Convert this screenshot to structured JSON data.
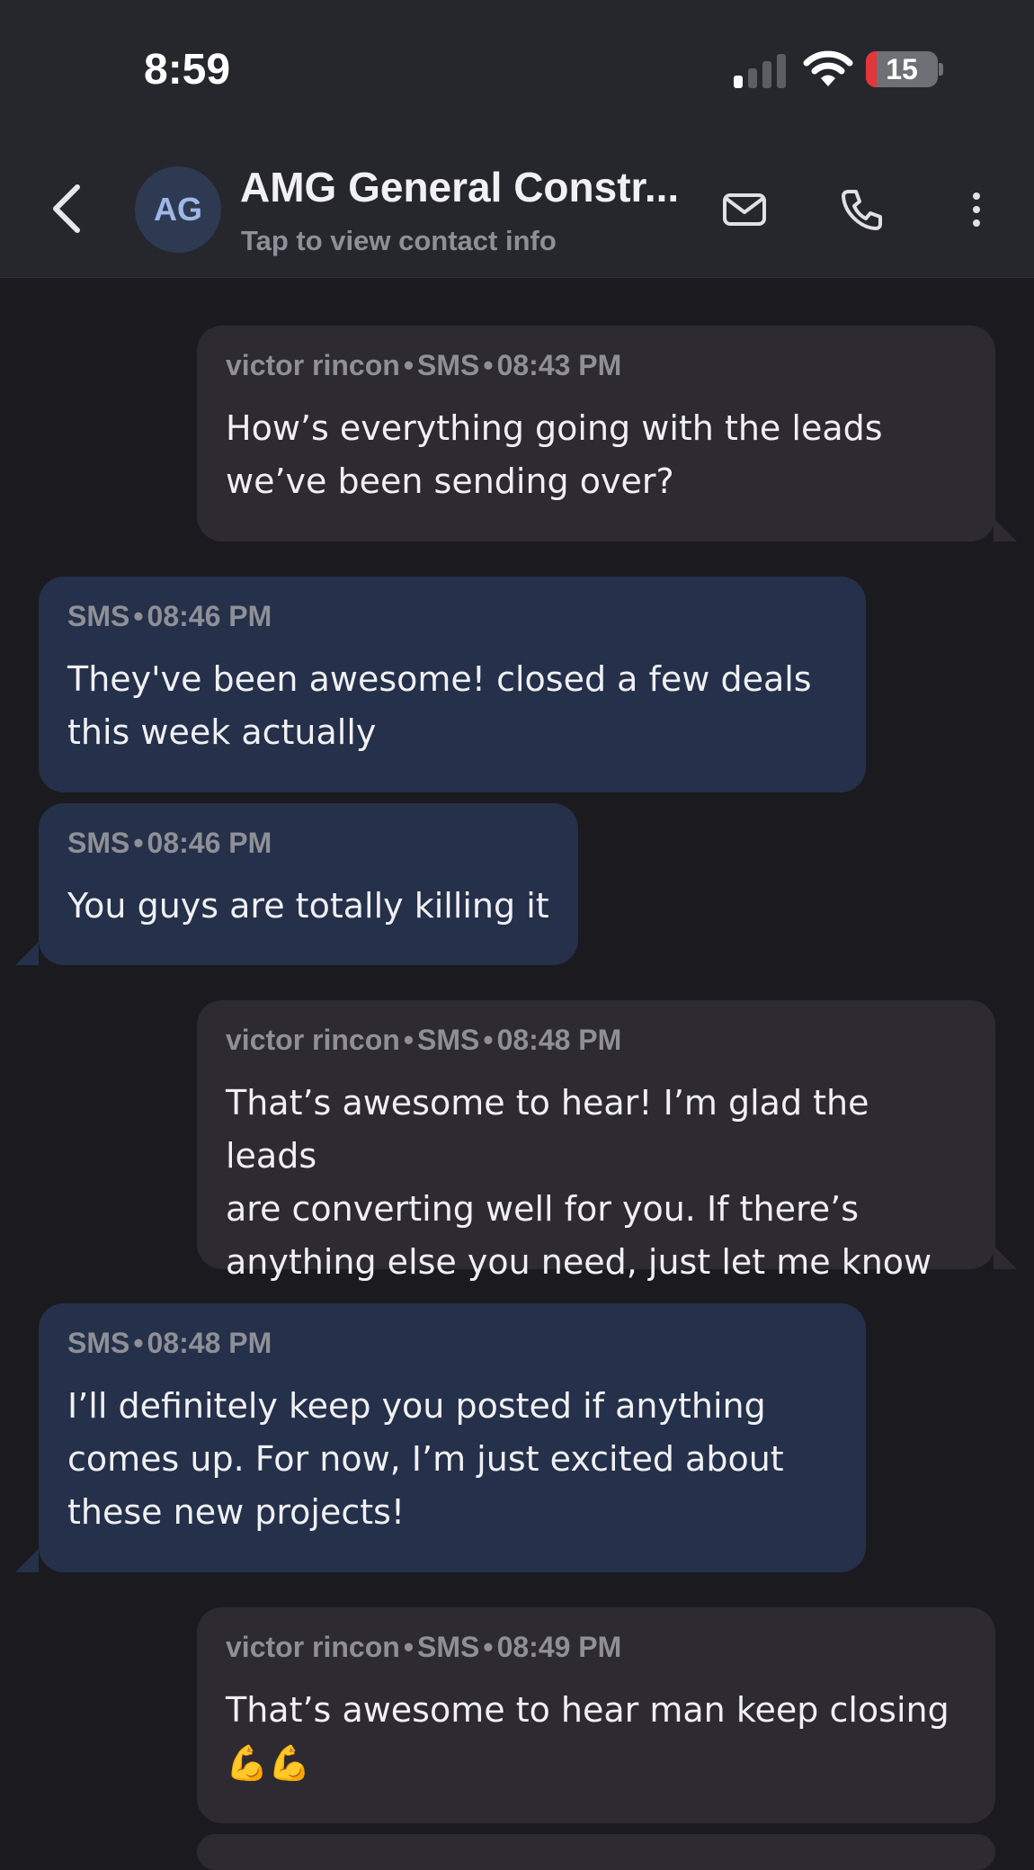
{
  "status_bar": {
    "time": "8:59",
    "battery_level": "15",
    "signal_icon": "cellular-signal-icon",
    "wifi_icon": "wifi-icon",
    "battery_icon": "battery-icon"
  },
  "header": {
    "back_icon": "chevron-left-icon",
    "avatar_initials": "AG",
    "contact_name": "AMG General Constr...",
    "subtitle": "Tap to view contact info",
    "email_icon": "mail-icon",
    "phone_icon": "phone-icon",
    "more_icon": "more-vertical-icon"
  },
  "colors": {
    "background": "#1b1b1f",
    "header": "#26272c",
    "outgoing_bubble": "#2d2a31",
    "incoming_bubble": "#25304a",
    "battery_low": "#e3363a"
  },
  "messages": [
    {
      "direction": "outgoing",
      "sender": "victor rincon",
      "channel": "SMS",
      "time": "08:43 PM",
      "text": "How’s everything going with the leads\nwe’ve been sending over?"
    },
    {
      "direction": "incoming",
      "channel": "SMS",
      "time": "08:46 PM",
      "text": "They've been awesome! closed a few deals\nthis week actually"
    },
    {
      "direction": "incoming",
      "channel": "SMS",
      "time": "08:46 PM",
      "text": "You guys are totally killing it"
    },
    {
      "direction": "outgoing",
      "sender": "victor rincon",
      "channel": "SMS",
      "time": "08:48 PM",
      "text": "That’s awesome to hear! I’m glad the leads\nare converting well for you. If there’s\nanything else you need, just let me know"
    },
    {
      "direction": "incoming",
      "channel": "SMS",
      "time": "08:48 PM",
      "text": "I’ll definitely keep you posted if anything\ncomes up. For now, I’m just excited about\nthese new projects!"
    },
    {
      "direction": "outgoing",
      "sender": "victor rincon",
      "channel": "SMS",
      "time": "08:49 PM",
      "text": "That’s awesome to hear man keep closing\n💪💪"
    }
  ]
}
